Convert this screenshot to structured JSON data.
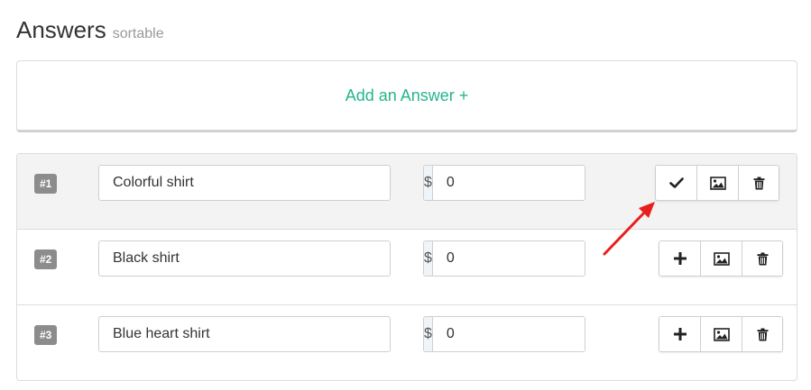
{
  "header": {
    "title": "Answers",
    "subtitle": "sortable"
  },
  "add_answer": {
    "label": "Add an Answer +"
  },
  "answers": [
    {
      "badge": "#1",
      "name": "Colorful shirt",
      "currency": "$",
      "price": "0",
      "state_icon": "checkmark-icon",
      "selected": true
    },
    {
      "badge": "#2",
      "name": "Black shirt",
      "currency": "$",
      "price": "0",
      "state_icon": "plus-icon",
      "selected": false
    },
    {
      "badge": "#3",
      "name": "Blue heart shirt",
      "currency": "$",
      "price": "0",
      "state_icon": "plus-icon",
      "selected": false
    }
  ],
  "colors": {
    "accent": "#26b48c",
    "annotation_arrow": "#e8201c",
    "badge": "#8c8c8c"
  }
}
